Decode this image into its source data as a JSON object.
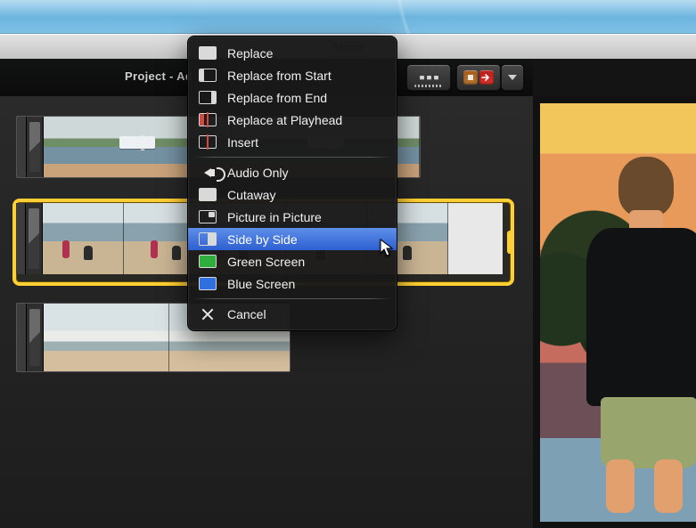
{
  "app": {
    "title": "iMovie"
  },
  "project_header": {
    "crumb": "Project - Ad"
  },
  "toolbar": {
    "view_switcher": {
      "name": "thumbnail-size-switcher"
    },
    "share_well": {
      "name": "share-well"
    },
    "dropdown": {
      "name": "project-options-dropdown"
    }
  },
  "clips": {
    "row1": {
      "name": "clip-strip-harbor"
    },
    "row2": {
      "name": "clip-strip-beach-selected"
    },
    "row3": {
      "name": "clip-strip-waves"
    }
  },
  "preview": {
    "name": "viewer"
  },
  "context_menu": {
    "items": [
      {
        "id": "replace",
        "label": "Replace",
        "icon": "replace-icon"
      },
      {
        "id": "replace_from_start",
        "label": "Replace from Start",
        "icon": "replace-from-start-icon"
      },
      {
        "id": "replace_from_end",
        "label": "Replace from End",
        "icon": "replace-from-end-icon"
      },
      {
        "id": "replace_at_playhead",
        "label": "Replace at Playhead",
        "icon": "replace-at-playhead-icon"
      },
      {
        "id": "insert",
        "label": "Insert",
        "icon": "insert-icon"
      },
      {
        "id": "audio_only",
        "label": "Audio Only",
        "icon": "audio-only-icon"
      },
      {
        "id": "cutaway",
        "label": "Cutaway",
        "icon": "cutaway-icon"
      },
      {
        "id": "pip",
        "label": "Picture in Picture",
        "icon": "picture-in-picture-icon"
      },
      {
        "id": "side_by_side",
        "label": "Side by Side",
        "icon": "side-by-side-icon",
        "hover": true
      },
      {
        "id": "green_screen",
        "label": "Green Screen",
        "icon": "green-screen-icon"
      },
      {
        "id": "blue_screen",
        "label": "Blue Screen",
        "icon": "blue-screen-icon"
      },
      {
        "id": "cancel",
        "label": "Cancel",
        "icon": "cancel-icon"
      }
    ]
  }
}
